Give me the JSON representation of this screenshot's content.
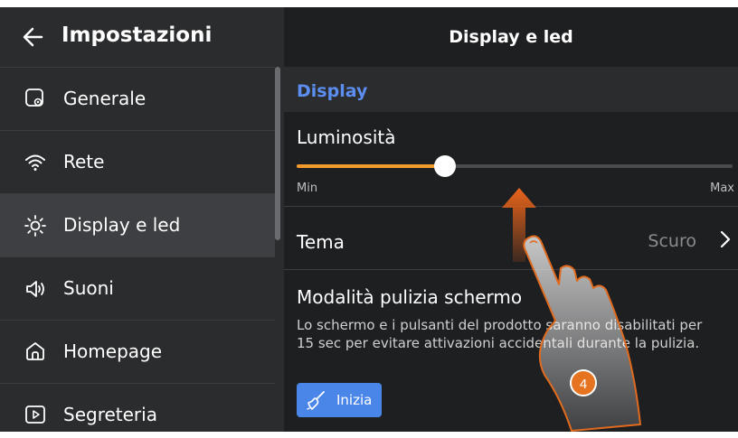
{
  "sidebar": {
    "title": "Impostazioni",
    "items": [
      {
        "label": "Generale",
        "icon": "general-settings-icon"
      },
      {
        "label": "Rete",
        "icon": "wifi-icon"
      },
      {
        "label": "Display e led",
        "icon": "sun-icon",
        "active": true
      },
      {
        "label": "Suoni",
        "icon": "speaker-icon"
      },
      {
        "label": "Homepage",
        "icon": "home-icon"
      },
      {
        "label": "Segreteria",
        "icon": "play-icon"
      }
    ]
  },
  "panel": {
    "title": "Display e led",
    "section": "Display",
    "brightness": {
      "label": "Luminosità",
      "min_label": "Min",
      "max_label": "Max",
      "level": 0.34
    },
    "theme": {
      "label": "Tema",
      "value": "Scuro"
    },
    "cleaning": {
      "label": "Modalità pulizia schermo",
      "description_line1": "Lo schermo e i pulsanti del prodotto saranno disabilitati per",
      "description_line2": "15 sec per evitare attivazioni accidentali durante la pulizia.",
      "button_label": "Inizia"
    }
  },
  "annotation": {
    "step_number": "4"
  },
  "colors": {
    "accent": "#f39a2d",
    "section_title": "#5b8ef0",
    "button": "#4a86e8"
  }
}
